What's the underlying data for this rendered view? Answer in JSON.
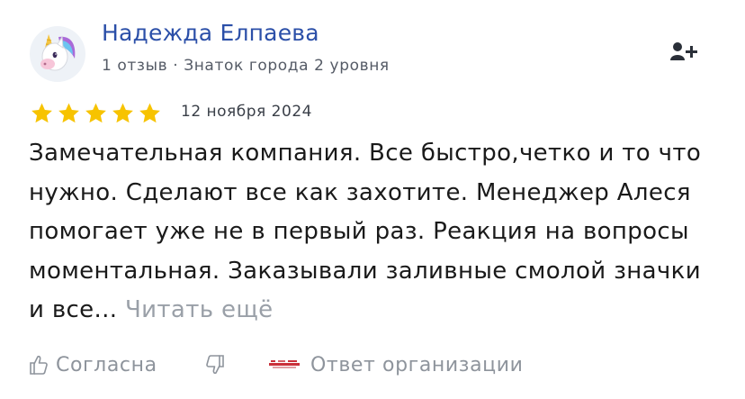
{
  "author": {
    "name": "Надежда Елпаева",
    "meta": "1 отзыв · Знаток города 2 уровня",
    "avatar_icon": "unicorn-emoji-icon"
  },
  "review": {
    "rating": 5,
    "rating_max": 5,
    "date": "12 ноября 2024",
    "text": "Замечательная компания. Все быстро,четко и то что нужно. Сделают все как захотите. Менеджер Алеся помогает уже не в первый раз. Реакция на вопросы моментальная. Заказывали заливные смолой значки и все...",
    "read_more": "Читать ещё"
  },
  "actions": {
    "agree_label": "Согласна",
    "dislike_icon": "thumbs-down-icon",
    "reply_label": "Ответ организации",
    "subscribe_icon": "add-user-icon"
  },
  "colors": {
    "name": "#2b4fa8",
    "star": "#f7c300",
    "muted": "#8e949c",
    "text": "#1a1a1a"
  }
}
